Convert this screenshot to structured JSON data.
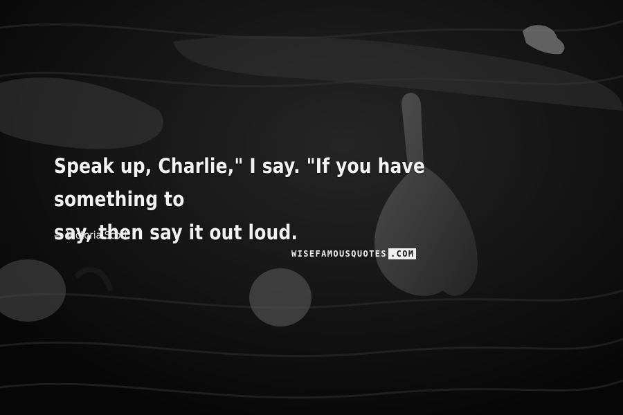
{
  "quote": {
    "line1": "Speak up, Charlie,\" I say. \"If you have something to",
    "line2": "say, then say it out loud."
  },
  "author": {
    "dash": "—",
    "name": "Victoria Scott"
  },
  "brand": {
    "main": "WISEFAMOUSQUOTES",
    "com": ".COM"
  },
  "colors": {
    "text": "#f2f2f2",
    "background": "#161616"
  }
}
